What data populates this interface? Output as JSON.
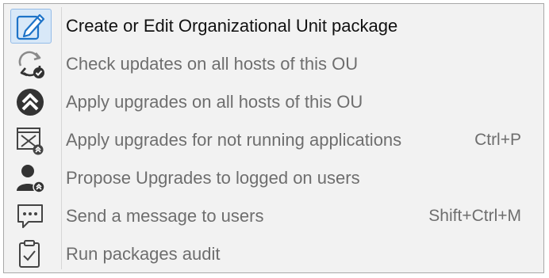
{
  "menu": {
    "items": [
      {
        "label": "Create or Edit Organizational Unit package",
        "shortcut": "",
        "icon": "edit-pencil-icon",
        "enabled": true
      },
      {
        "label": "Check updates on all hosts of this OU",
        "shortcut": "",
        "icon": "refresh-check-icon",
        "enabled": false
      },
      {
        "label": "Apply upgrades on all hosts of this OU",
        "shortcut": "",
        "icon": "double-chevron-up-icon",
        "enabled": false
      },
      {
        "label": "Apply upgrades for not running applications",
        "shortcut": "Ctrl+P",
        "icon": "closed-window-upgrade-icon",
        "enabled": false
      },
      {
        "label": "Propose Upgrades to logged on users",
        "shortcut": "",
        "icon": "user-upgrade-icon",
        "enabled": false
      },
      {
        "label": "Send a message to users",
        "shortcut": "Shift+Ctrl+M",
        "icon": "message-bubble-icon",
        "enabled": false
      },
      {
        "label": "Run packages audit",
        "shortcut": "",
        "icon": "clipboard-check-icon",
        "enabled": false
      }
    ]
  },
  "colors": {
    "menu_background": "#f2f2f2",
    "highlight_fill": "#d8e8f8",
    "highlight_border": "#94bce8",
    "enabled_text": "#111111",
    "disabled_text": "#6e6e6e",
    "icon_dark": "#333333",
    "accent_blue": "#1e73c8"
  }
}
